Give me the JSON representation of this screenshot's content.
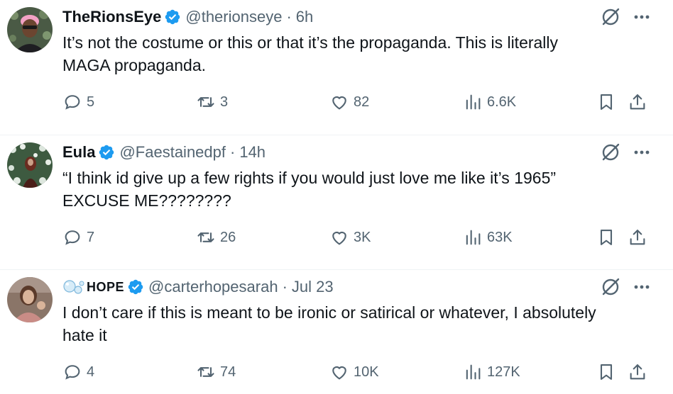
{
  "tweets": [
    {
      "display_name": "TheRionsEye",
      "handle": "@therionseye",
      "separator": "·",
      "time": "6h",
      "text_line1": "It’s not the costume or this or that it’s the propaganda. This is literally",
      "text_line2": "MAGA propaganda.",
      "replies": "5",
      "reposts": "3",
      "likes": "82",
      "views": "6.6K"
    },
    {
      "display_name": "Eula",
      "handle": "@Faestainedpf",
      "separator": "·",
      "time": "14h",
      "text_line1": "“I think id give up a few rights if you would just love me like it’s 1965”",
      "text_line2": "EXCUSE ME????????",
      "replies": "7",
      "reposts": "26",
      "likes": "3K",
      "views": "63K"
    },
    {
      "display_name": "HOPE",
      "display_name_prefix_icon": "bubbles-emoji-icon",
      "handle": "@carterhopesarah",
      "separator": "·",
      "time": "Jul 23",
      "text_line1": "I don’t care if this is meant to be ironic or satirical or whatever, I absolutely",
      "text_line2": "hate it",
      "replies": "4",
      "reposts": "74",
      "likes": "10K",
      "views": "127K"
    }
  ],
  "colors": {
    "text": "#0f1419",
    "secondary": "#536471",
    "verified": "#1d9bf0",
    "divider": "#eff3f4"
  },
  "icons": [
    "reply-icon",
    "repost-icon",
    "like-icon",
    "views-icon",
    "bookmark-icon",
    "share-icon",
    "grok-icon",
    "more-icon",
    "verified-badge-icon"
  ]
}
